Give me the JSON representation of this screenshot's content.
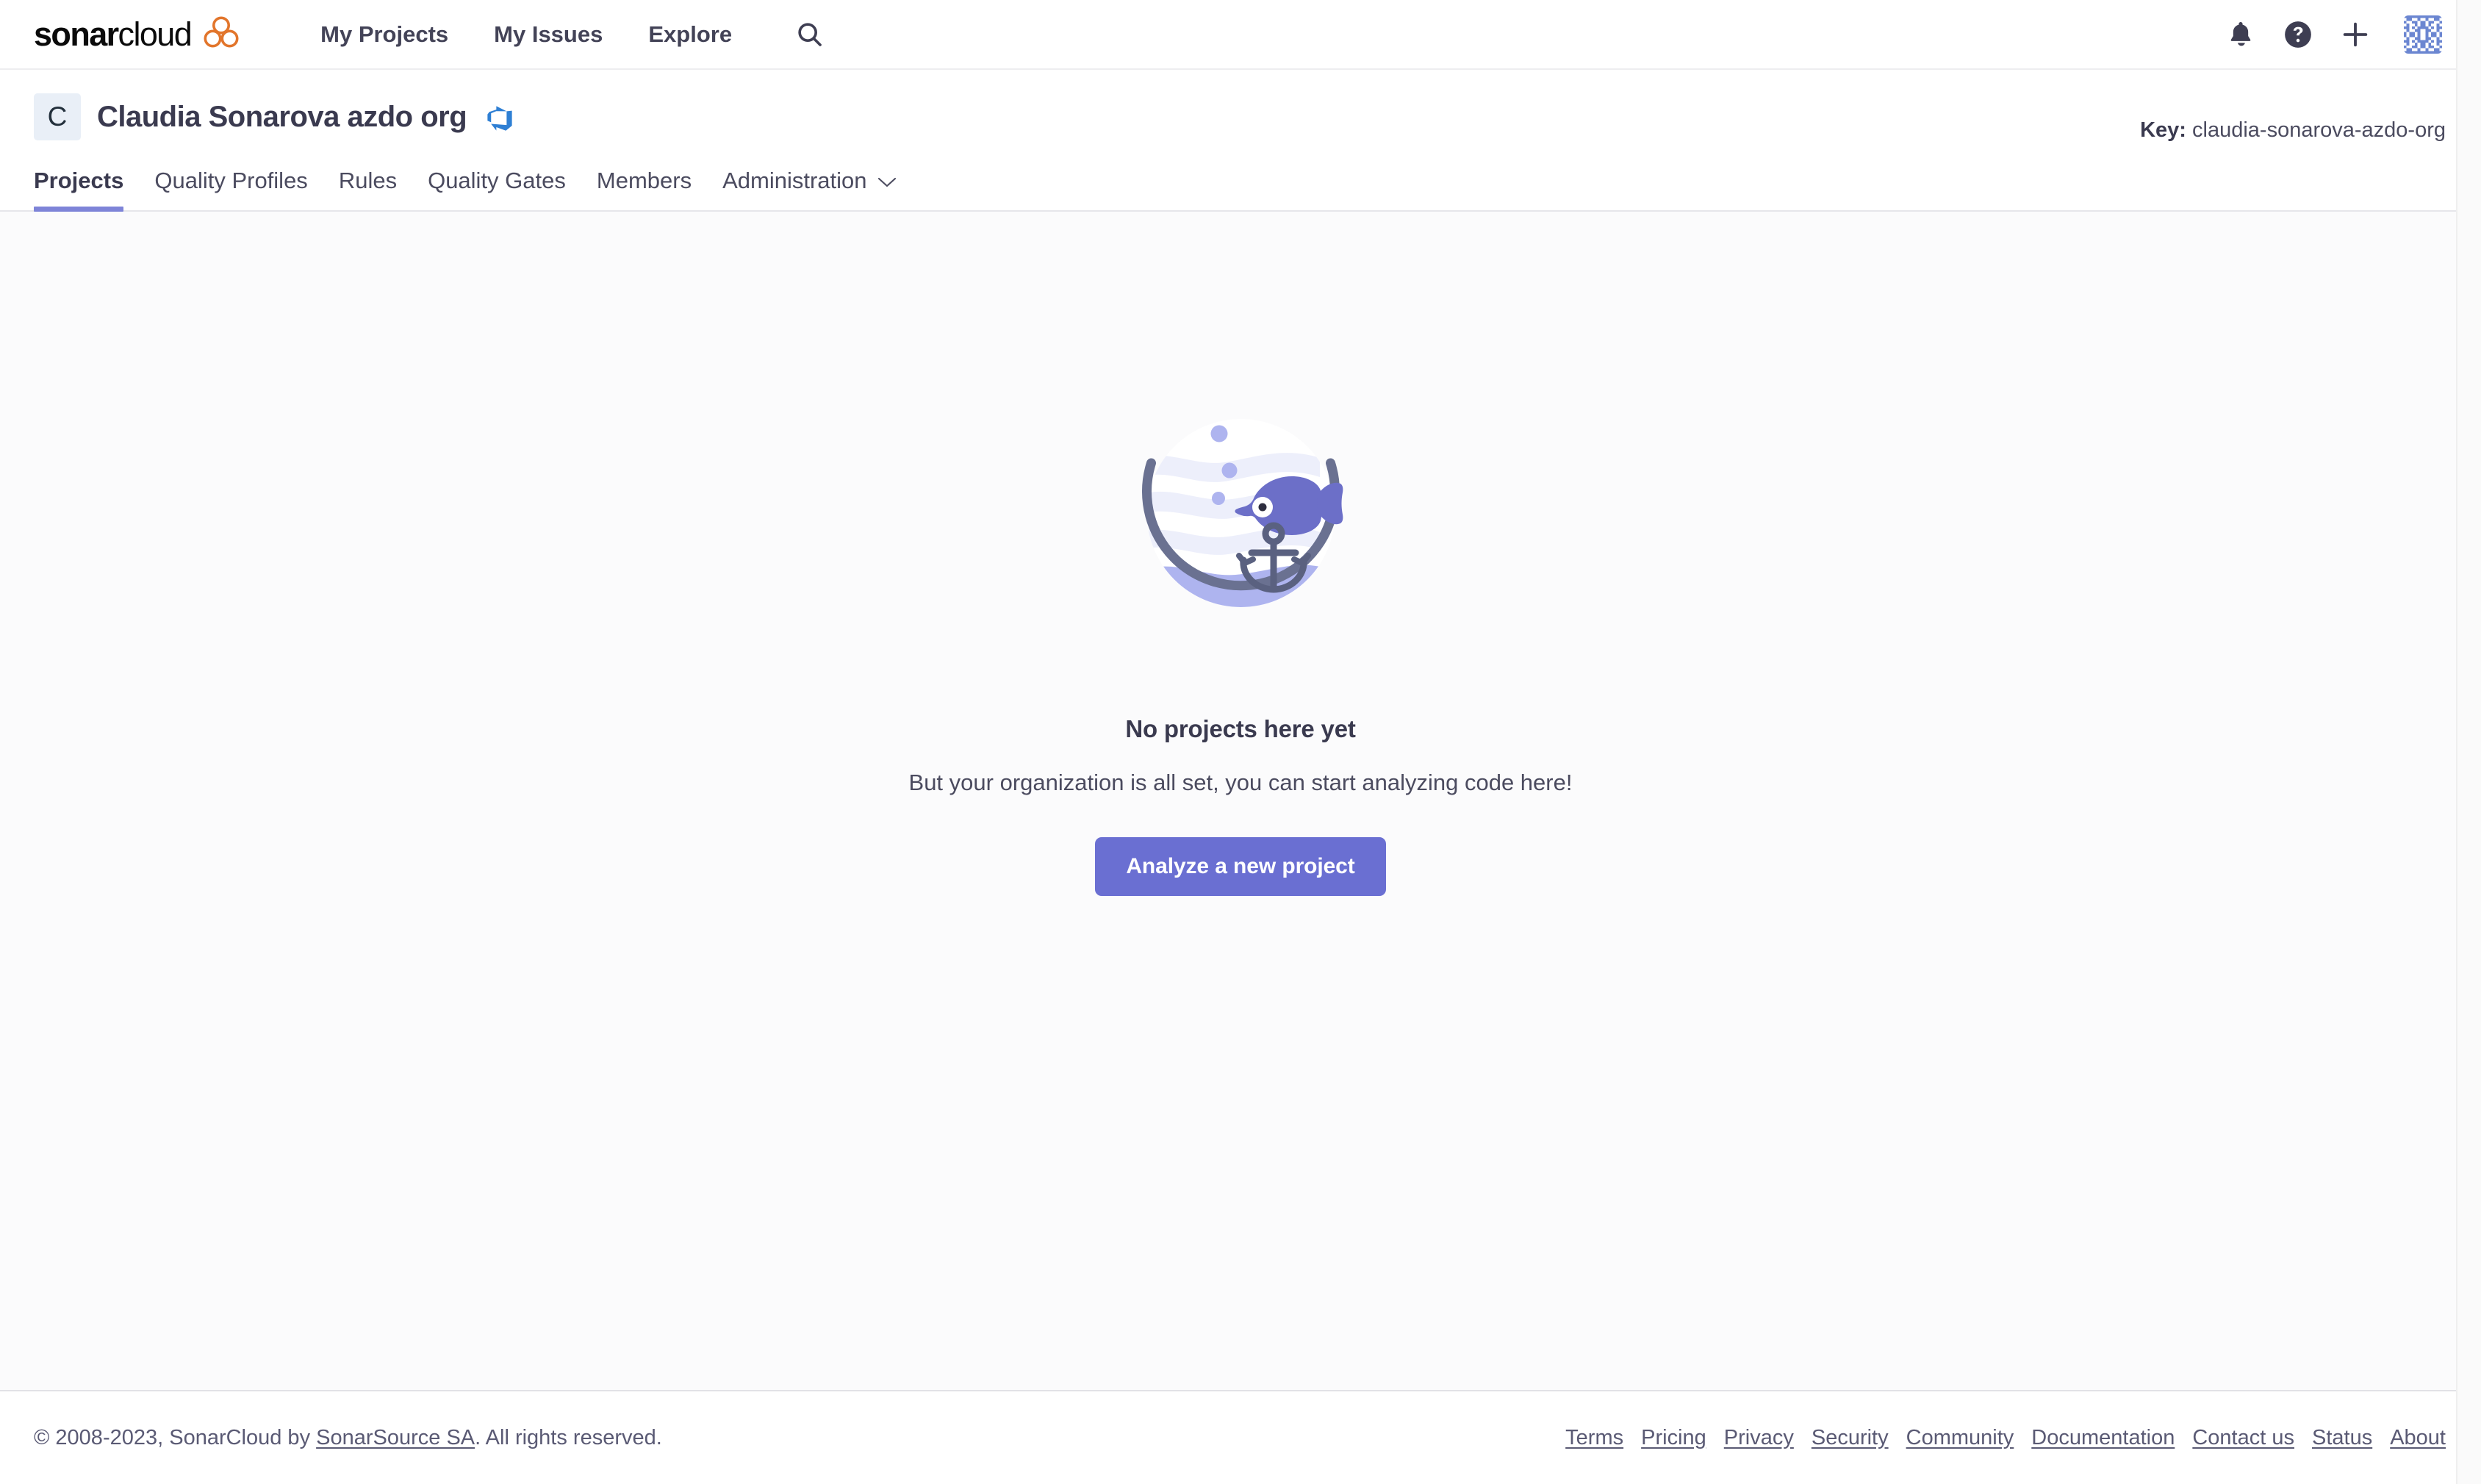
{
  "colors": {
    "brand_orange": "#E2752B",
    "brand_black": "#0B0B0B",
    "accent_purple": "#6A6FD2",
    "tab_underline": "#7E84D8",
    "text_primary": "#3A3A4F",
    "text_secondary": "#4B4B5F",
    "footer_text": "#5A5A74",
    "page_background": "#FBFBFC",
    "panel_background": "#FFFFFF",
    "org_avatar_background": "#E9EFF7",
    "azure_devops_blue": "#2E7FD4",
    "illustration_bowl": "#6A7191",
    "illustration_fish": "#6C6FC8",
    "illustration_water": "#AEB4EF",
    "illustration_waves": "#EDEFFB",
    "identicon_blue": "#6B86D1"
  },
  "global_nav": {
    "logo": {
      "word_bold": "sonar",
      "word_light": "cloud",
      "mark_name": "sonarcloud-cloud-mark"
    },
    "links": [
      {
        "label": "My Projects",
        "name": "nav-link-my-projects"
      },
      {
        "label": "My Issues",
        "name": "nav-link-my-issues"
      },
      {
        "label": "Explore",
        "name": "nav-link-explore"
      }
    ],
    "search_icon": "search-icon",
    "right_icons": [
      {
        "name": "notifications-bell-icon",
        "label": "Notifications"
      },
      {
        "name": "help-circle-icon",
        "label": "Help"
      },
      {
        "name": "plus-icon",
        "label": "Create"
      }
    ],
    "avatar": {
      "name": "user-avatar-identicon",
      "label": "Account"
    }
  },
  "org_header": {
    "avatar_initial": "C",
    "title": "Claudia Sonarova azdo org",
    "alm_icon": "azure-devops-icon",
    "key_label": "Key:",
    "key_value": "claudia-sonarova-azdo-org",
    "tabs": [
      {
        "label": "Projects",
        "active": true,
        "has_chevron": false
      },
      {
        "label": "Quality Profiles",
        "active": false,
        "has_chevron": false
      },
      {
        "label": "Rules",
        "active": false,
        "has_chevron": false
      },
      {
        "label": "Quality Gates",
        "active": false,
        "has_chevron": false
      },
      {
        "label": "Members",
        "active": false,
        "has_chevron": false
      },
      {
        "label": "Administration",
        "active": false,
        "has_chevron": true
      }
    ]
  },
  "empty_state": {
    "illustration_name": "fishbowl-empty-illustration",
    "title": "No projects here yet",
    "subtitle": "But your organization is all set, you can start analyzing code here!",
    "button_label": "Analyze a new project"
  },
  "footer": {
    "copyright_prefix": "© 2008-2023, SonarCloud by ",
    "copyright_link": "SonarSource SA",
    "copyright_suffix": ". All rights reserved.",
    "links": [
      {
        "label": "Terms",
        "name": "footer-link-terms"
      },
      {
        "label": "Pricing",
        "name": "footer-link-pricing"
      },
      {
        "label": "Privacy",
        "name": "footer-link-privacy"
      },
      {
        "label": "Security",
        "name": "footer-link-security"
      },
      {
        "label": "Community",
        "name": "footer-link-community"
      },
      {
        "label": "Documentation",
        "name": "footer-link-documentation"
      },
      {
        "label": "Contact us",
        "name": "footer-link-contact-us"
      },
      {
        "label": "Status",
        "name": "footer-link-status"
      },
      {
        "label": "About",
        "name": "footer-link-about"
      }
    ]
  }
}
